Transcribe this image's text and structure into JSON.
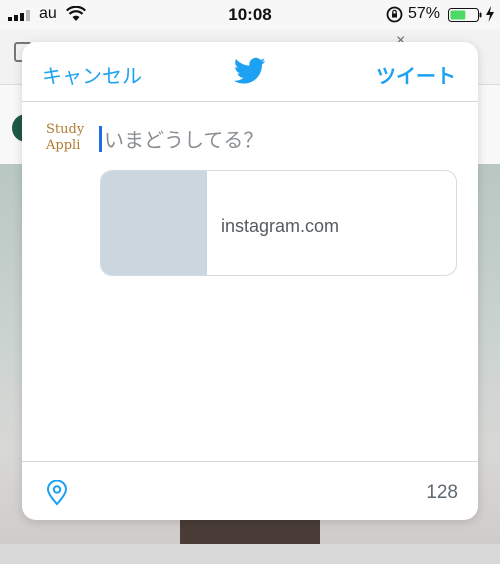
{
  "status_bar": {
    "carrier": "au",
    "time": "10:08",
    "battery_percent": "57%",
    "battery_level": 0.57,
    "battery_color": "#4cd964"
  },
  "compose": {
    "cancel_label": "キャンセル",
    "tweet_label": "ツイート",
    "placeholder": "いまどうしてる？",
    "avatar_text": [
      "Study",
      "Appli"
    ],
    "link_card_domain": "instagram.com",
    "char_count": "128",
    "accent_color": "#1da1f2"
  },
  "icons": {
    "header": "twitter-bird-icon",
    "footer": "location-pin-icon"
  }
}
